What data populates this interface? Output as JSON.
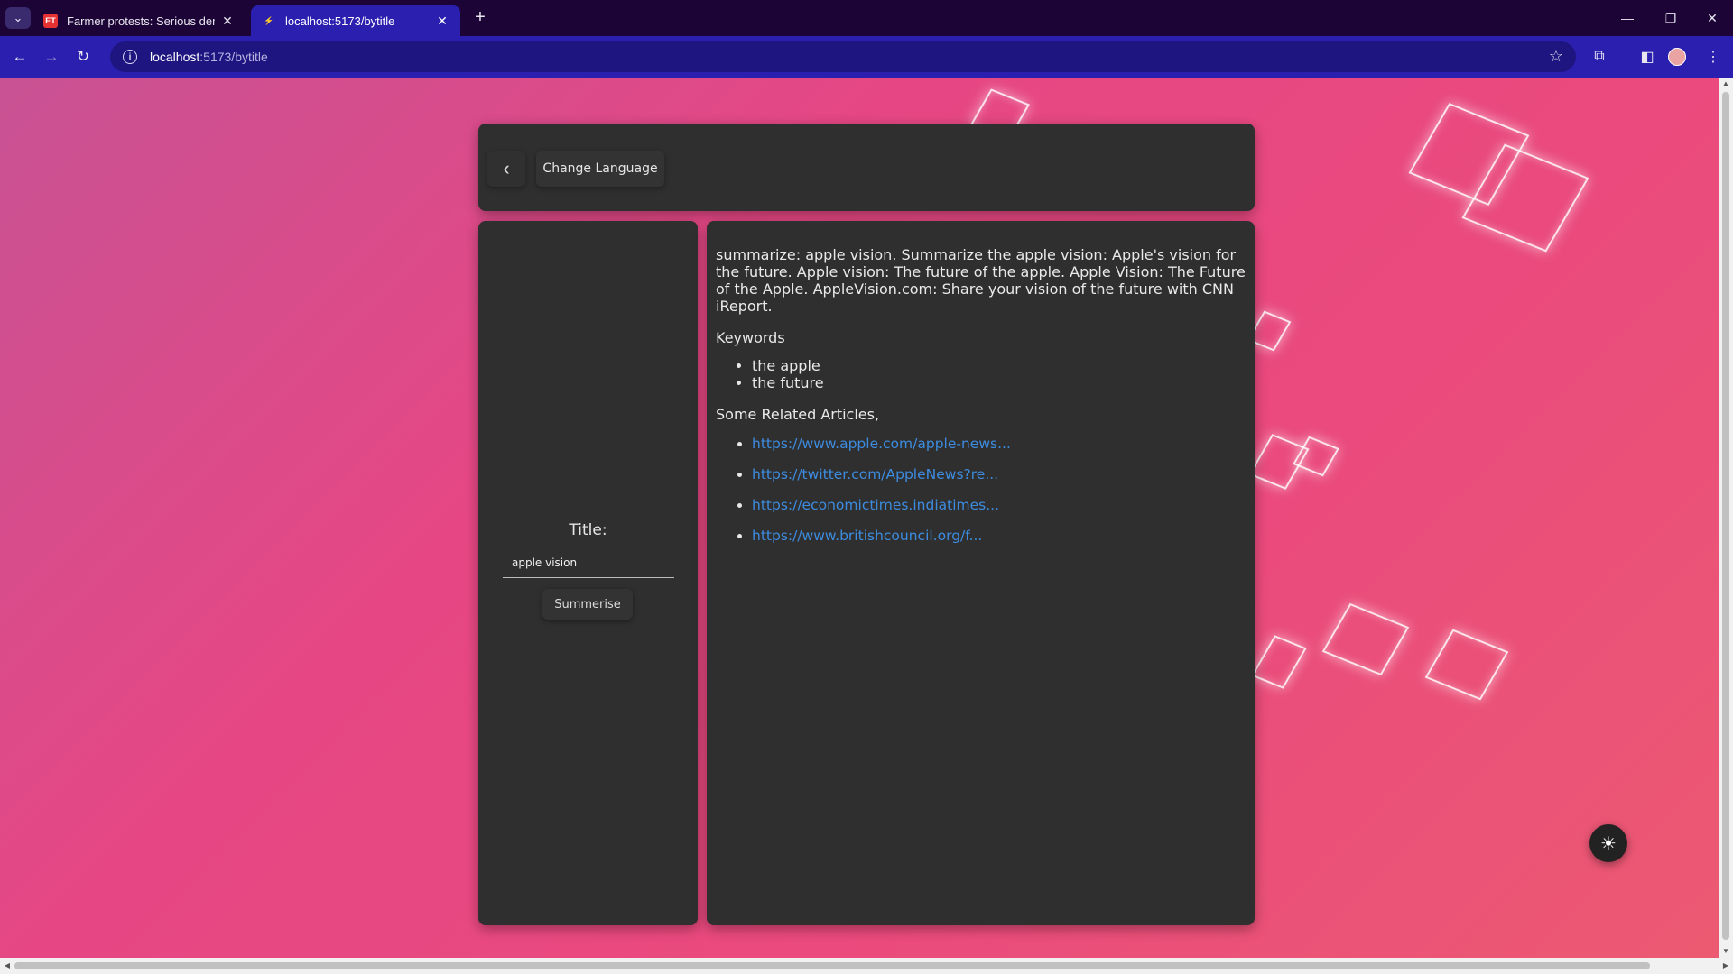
{
  "browser": {
    "tabs": [
      {
        "title": "Farmer protests: Serious deman",
        "favicon": "et-favicon-icon",
        "close": "✕"
      },
      {
        "title": "localhost:5173/bytitle",
        "favicon": "vite-favicon-icon",
        "close": "✕"
      }
    ],
    "new_tab": "+",
    "url_host": "localhost",
    "url_path": ":5173/bytitle",
    "window_controls": {
      "minimize": "—",
      "restore": "❐",
      "close": "✕"
    }
  },
  "header": {
    "back_icon": "‹",
    "change_language_label": "Change Language"
  },
  "form": {
    "title_label": "Title:",
    "title_value": "apple vision",
    "summarise_label": "Summerise"
  },
  "result": {
    "summary": "summarize: apple vision. Summarize the apple vision: Apple's vision for the future. Apple vision: The future of the apple. Apple Vision: The Future of the Apple. AppleVision.com: Share your vision of the future with CNN iReport.",
    "keywords_label": "Keywords",
    "keywords": [
      "the apple",
      "the future"
    ],
    "related_label": "Some Related Articles,",
    "links": [
      "https://www.apple.com/apple-news...",
      "https://twitter.com/AppleNews?re...",
      "https://economictimes.indiatimes...",
      "https://www.britishcouncil.org/f..."
    ]
  },
  "theme_toggle_icon": "☀",
  "colors": {
    "chrome_dark": "#1c0536",
    "chrome_accent": "#2b1fb0",
    "card_bg": "#2f2f2f",
    "link": "#3d8ce0",
    "page_gradient_start": "#c85294",
    "page_gradient_end": "#ec5a72"
  }
}
